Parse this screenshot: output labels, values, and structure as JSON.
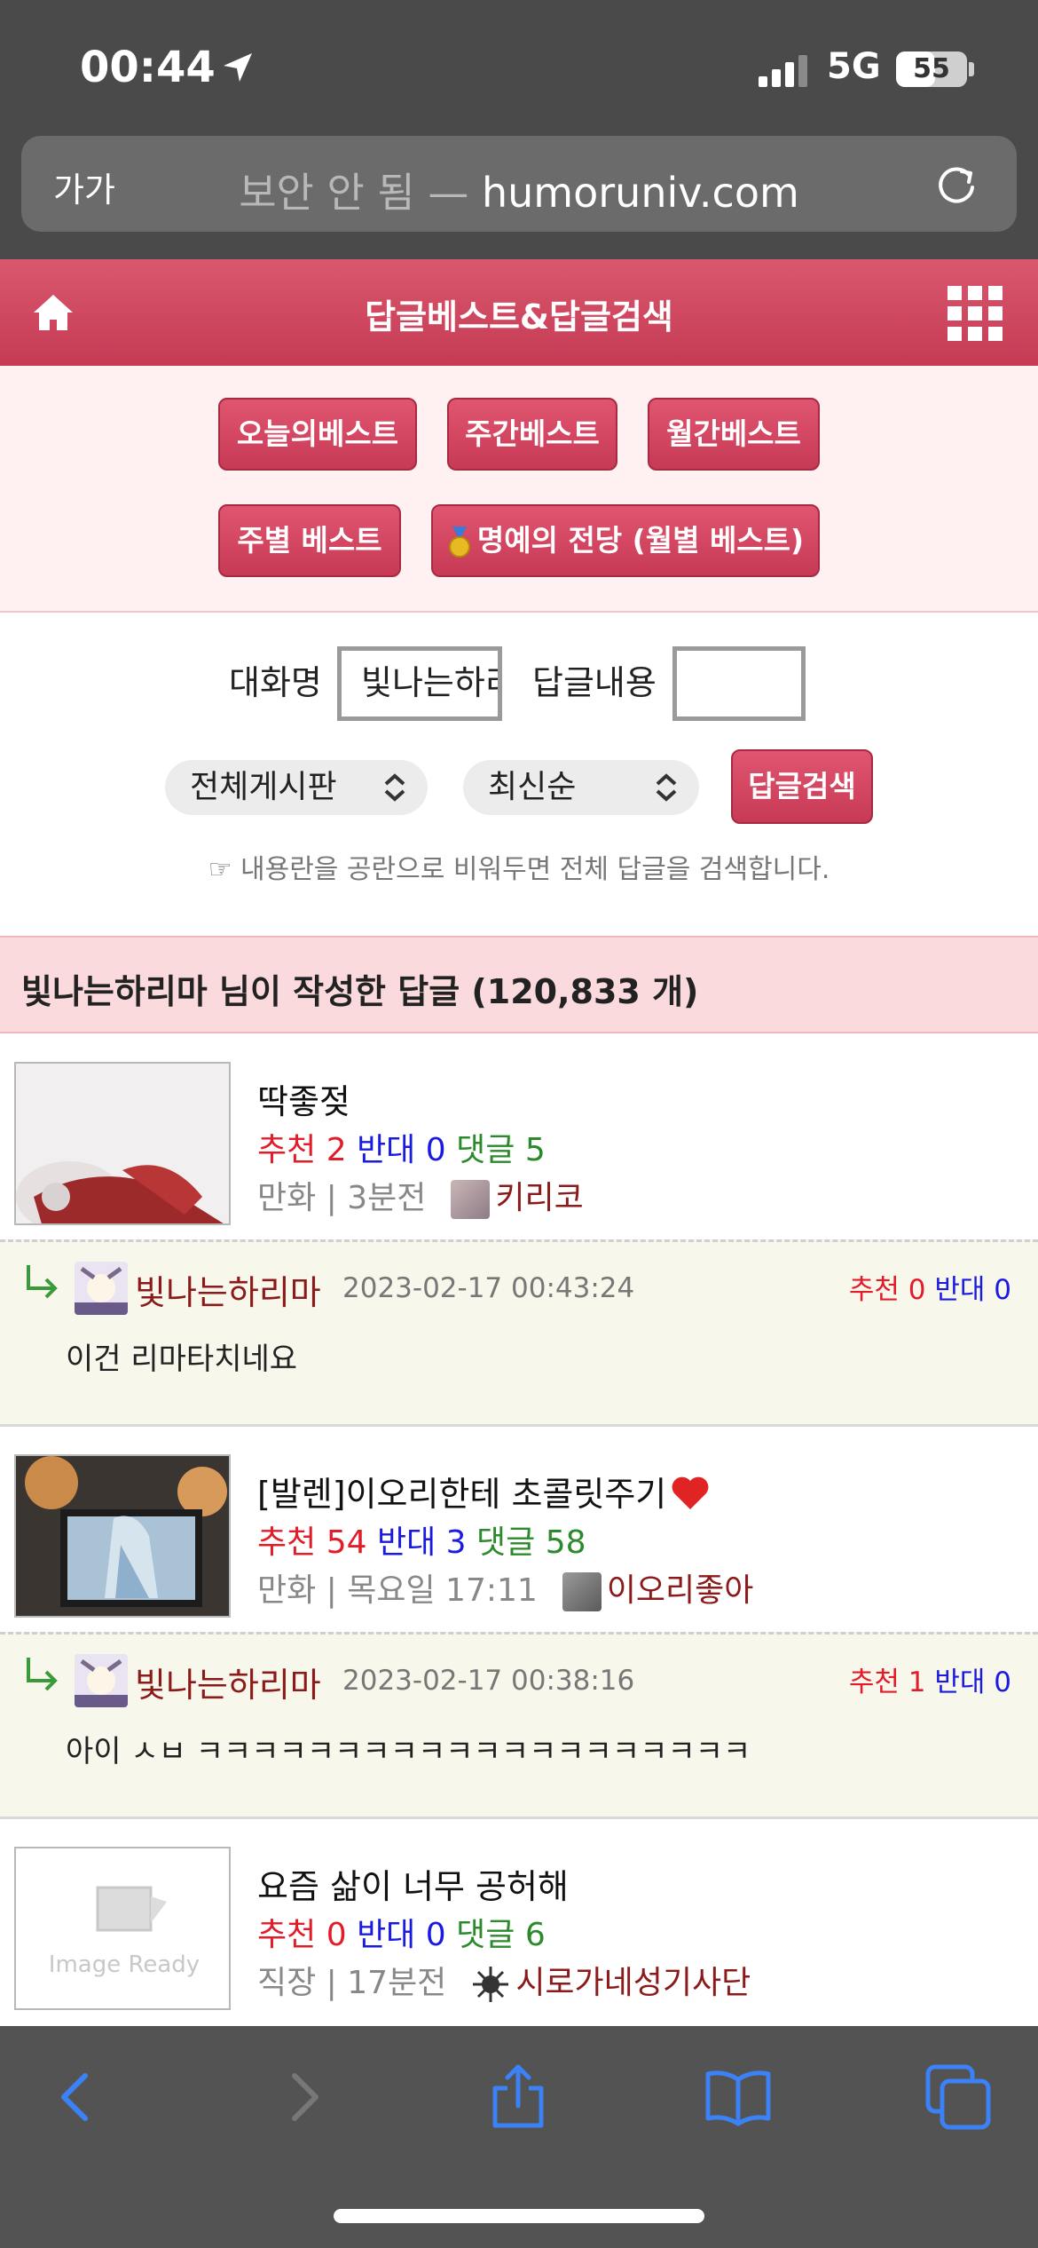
{
  "status": {
    "time": "00:44",
    "network": "5G",
    "battery": "55",
    "battery_level": 0.55
  },
  "browser": {
    "aa": "가가",
    "security": "보안 안 됨 —",
    "host": "humoruniv.com",
    "back_icon": "chevron-left-icon",
    "forward_icon": "chevron-right-icon",
    "share_icon": "share-icon",
    "bookmarks_icon": "book-icon",
    "tabs_icon": "tabs-icon"
  },
  "header": {
    "title": "답글베스트&답글검색",
    "home_icon": "home-icon",
    "menu_icon": "grid-menu-icon"
  },
  "best_buttons": {
    "today": "오늘의베스트",
    "weekly": "주간베스트",
    "monthly": "월간베스트",
    "by_week": "주별 베스트",
    "hall_of_fame": "명예의 전당 (월별 베스트)"
  },
  "search": {
    "nick_label": "대화명",
    "nick_value": "빛나는하리마",
    "content_label": "답글내용",
    "content_value": "",
    "board_select": "전체게시판",
    "order_select": "최신순",
    "search_button": "답글검색",
    "hint": "☞ 내용란을 공란으로 비워두면 전체 답글을 검색합니다."
  },
  "results": {
    "title": "빛나는하리마 님이 작성한 답글 (120,833 개)"
  },
  "labels": {
    "recommend": "추천",
    "oppose": "반대",
    "comments": "댓글"
  },
  "posts": [
    {
      "title": "딱좋젖",
      "recommend": "2",
      "oppose": "0",
      "comments": "5",
      "meta": "만화 | 3분전",
      "author": "키리코",
      "reply": {
        "author": "빛나는하리마",
        "date": "2023-02-17 00:43:24",
        "recommend": "0",
        "oppose": "0",
        "text": "이건 리마타치네요"
      }
    },
    {
      "title": "[발렌]이오리한테 초콜릿주기",
      "title_icon": "heart-icon",
      "recommend": "54",
      "oppose": "3",
      "comments": "58",
      "meta": "만화 | 목요일 17:11",
      "author": "이오리좋아",
      "reply": {
        "author": "빛나는하리마",
        "date": "2023-02-17 00:38:16",
        "recommend": "1",
        "oppose": "0",
        "text": "아이 ㅅㅂ ㅋㅋㅋㅋㅋㅋㅋㅋㅋㅋㅋㅋㅋㅋㅋㅋㅋㅋㅋㅋ"
      }
    },
    {
      "title": "요즘 삶이 너무 공허해",
      "recommend": "0",
      "oppose": "0",
      "comments": "6",
      "meta": "직장 | 17분전",
      "author": "시로가네성기사단",
      "thumb_text": "Image Ready"
    }
  ]
}
